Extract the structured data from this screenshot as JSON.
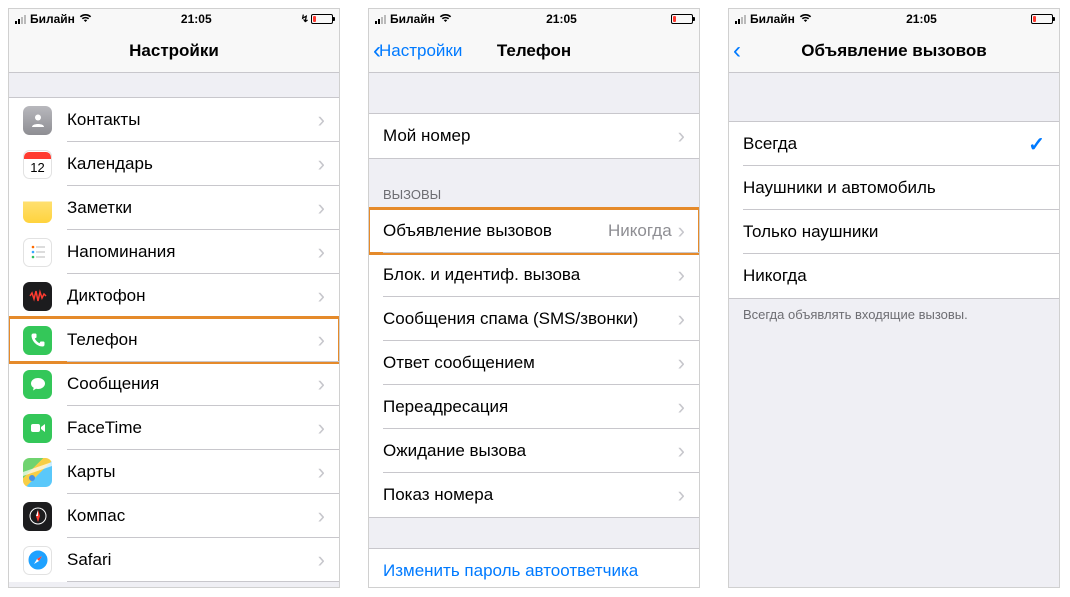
{
  "statusbar": {
    "carrier": "Билайн",
    "time": "21:05"
  },
  "screen1": {
    "title": "Настройки",
    "rows": [
      {
        "label": "Контакты",
        "icon": "contacts"
      },
      {
        "label": "Календарь",
        "icon": "calendar"
      },
      {
        "label": "Заметки",
        "icon": "notes"
      },
      {
        "label": "Напоминания",
        "icon": "reminders"
      },
      {
        "label": "Диктофон",
        "icon": "voice"
      },
      {
        "label": "Телефон",
        "icon": "phone",
        "highlight": true
      },
      {
        "label": "Сообщения",
        "icon": "messages"
      },
      {
        "label": "FaceTime",
        "icon": "facetime"
      },
      {
        "label": "Карты",
        "icon": "maps"
      },
      {
        "label": "Компас",
        "icon": "compass"
      },
      {
        "label": "Safari",
        "icon": "safari"
      }
    ]
  },
  "screen2": {
    "back": "Настройки",
    "title": "Телефон",
    "my_number": "Мой номер",
    "section_header": "ВЫЗОВЫ",
    "rows": [
      {
        "label": "Объявление вызовов",
        "detail": "Никогда",
        "highlight": true
      },
      {
        "label": "Блок. и идентиф. вызова"
      },
      {
        "label": "Сообщения спама (SMS/звонки)"
      },
      {
        "label": "Ответ сообщением"
      },
      {
        "label": "Переадресация"
      },
      {
        "label": "Ожидание вызова"
      },
      {
        "label": "Показ номера"
      }
    ],
    "link": "Изменить пароль автоответчика"
  },
  "screen3": {
    "title": "Объявление вызовов",
    "options": [
      {
        "label": "Всегда",
        "selected": true
      },
      {
        "label": "Наушники и автомобиль"
      },
      {
        "label": "Только наушники"
      },
      {
        "label": "Никогда"
      }
    ],
    "footer": "Всегда объявлять входящие вызовы."
  }
}
